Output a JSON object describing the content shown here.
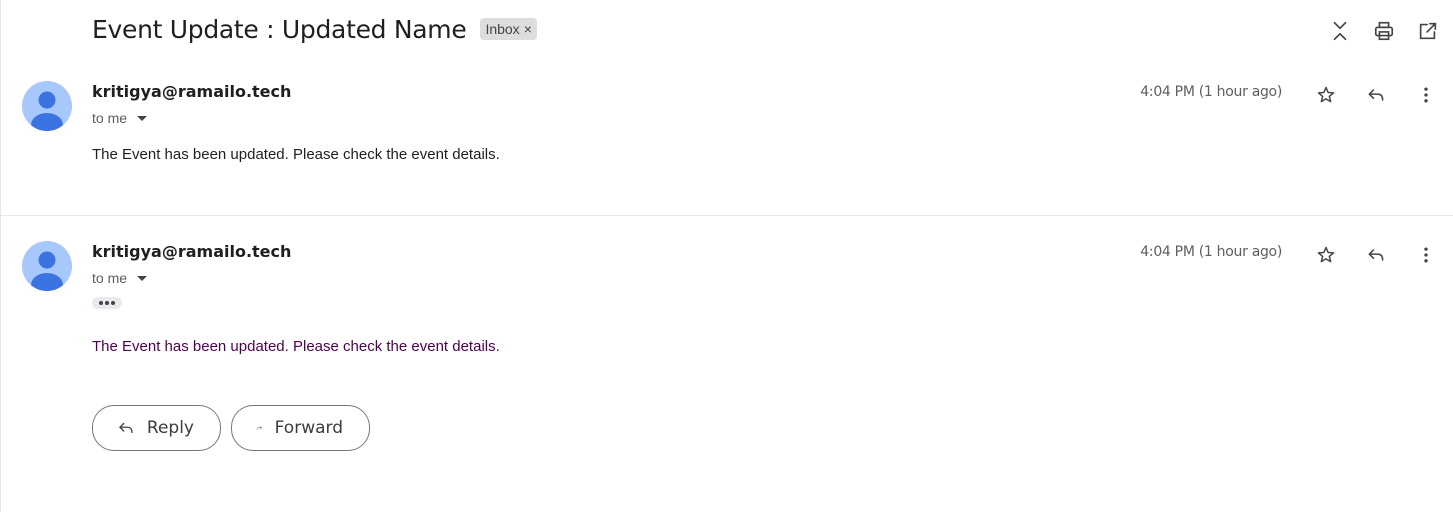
{
  "thread": {
    "subject": "Event Update : Updated Name",
    "label": "Inbox",
    "label_remove": "×"
  },
  "messages": [
    {
      "sender": "kritigya@ramailo.tech",
      "recipient": "to me",
      "time": "4:04 PM (1 hour ago)",
      "body": "The Event has been updated. Please check the event details."
    },
    {
      "sender": "kritigya@ramailo.tech",
      "recipient": "to me",
      "time": "4:04 PM (1 hour ago)",
      "body": "The Event has been updated. Please check the event details."
    }
  ],
  "actions": {
    "reply_label": "Reply",
    "forward_label": "Forward"
  },
  "icons": {
    "top": [
      "collapse-all-icon",
      "print-icon",
      "open-new-window-icon"
    ],
    "message": [
      "star-icon",
      "reply-icon",
      "more-vert-icon"
    ]
  },
  "colors": {
    "avatar_bg": "#a8c7fa",
    "avatar_fg": "#3b73e0",
    "quoted_text": "#500050",
    "label_chip_bg": "#dddddd"
  }
}
